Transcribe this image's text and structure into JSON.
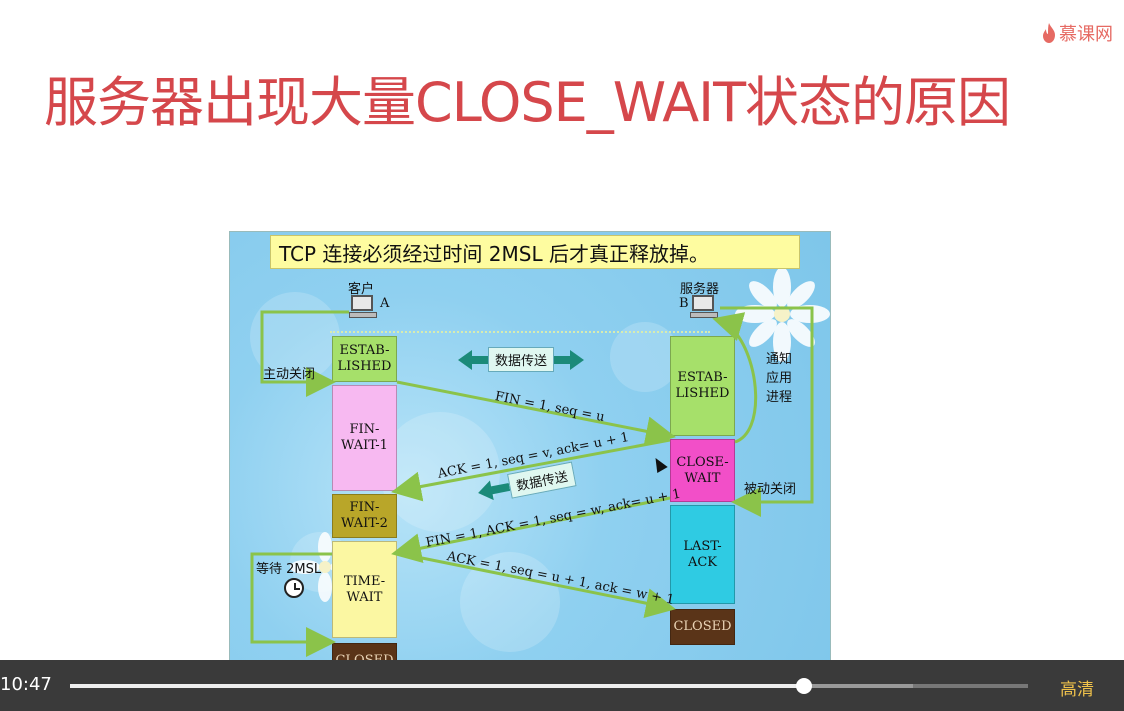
{
  "logo": {
    "text": "慕课网"
  },
  "slide": {
    "title": "服务器出现大量CLOSE_WAIT状态的原因"
  },
  "diagram": {
    "banner": "TCP 连接必须经过时间 2MSL 后才真正释放掉。",
    "client": {
      "label": "客户",
      "letter": "A"
    },
    "server": {
      "label": "服务器",
      "letter": "B"
    },
    "client_states": {
      "established": "ESTAB-\nLISHED",
      "fin_wait_1": "FIN-\nWAIT-1",
      "fin_wait_2": "FIN-\nWAIT-2",
      "time_wait": "TIME-\nWAIT",
      "closed": "CLOSED"
    },
    "server_states": {
      "established": "ESTAB-\nLISHED",
      "close_wait": "CLOSE-\nWAIT",
      "last_ack": "LAST-\nACK",
      "closed": "CLOSED"
    },
    "active_close": "主动关闭",
    "passive_close": "被动关闭",
    "notify_app": "通知\n应用\n进程",
    "wait_2msl": "等待 2MSL",
    "data_transfer_1": "数据传送",
    "data_transfer_2": "数据传送",
    "msg_fin1": "FIN = 1, seq = u",
    "msg_ack1": "ACK = 1, seq = v, ack= u + 1",
    "msg_fin2": "FIN = 1, ACK = 1, seq = w, ack= u + 1",
    "msg_ack2": "ACK = 1, seq = u + 1, ack = w + 1",
    "colors": {
      "established": "#a6e06a",
      "fin_wait_1": "#f7b9f1",
      "fin_wait_2": "#b9a629",
      "time_wait": "#fbf7a2",
      "closed": "#5a3418",
      "close_wait": "#f24fc8",
      "last_ack": "#2fcbe3",
      "arrow": "#8bc34a"
    }
  },
  "player": {
    "time": "10:47",
    "progress": 0.766,
    "buffered": 0.88,
    "quality": "高清"
  }
}
